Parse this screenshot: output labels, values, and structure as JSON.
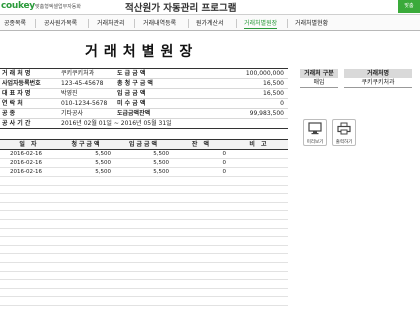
{
  "header": {
    "logo": "coukey",
    "logo_sub": "맞춤형엑셀업무자동화",
    "title": "적산원가 자동관리 프로그램",
    "corner_button": "맞춤"
  },
  "menu": [
    {
      "label": "공종목록",
      "active": false
    },
    {
      "label": "공사원가목록",
      "active": false
    },
    {
      "label": "거래처관리",
      "active": false
    },
    {
      "label": "거래내역등록",
      "active": false
    },
    {
      "label": "원가계산서",
      "active": false
    },
    {
      "label": "거래처별원장",
      "active": true
    },
    {
      "label": "거래처별현황",
      "active": false
    }
  ],
  "document": {
    "title": "거래처별원장"
  },
  "info": {
    "rows": [
      {
        "l1": "거 래 처 명",
        "v1": "쿠키쿠키처과",
        "l2": "도 급 금 액",
        "v2": "100,000,000"
      },
      {
        "l1": "사업자등록번호",
        "v1": "123-45-45678",
        "l2": "총 청 구 금 액",
        "v2": "16,500"
      },
      {
        "l1": "대 표 자 명",
        "v1": "박영진",
        "l2": "입 금 금 액",
        "v2": "16,500"
      },
      {
        "l1": "연 락 처",
        "v1": "010-1234-5678",
        "l2": "미 수 금 액",
        "v2": "0"
      },
      {
        "l1": "공 종",
        "v1": "기타공사",
        "l2": "도급금액잔액",
        "v2": "99,983,500"
      }
    ],
    "period_label": "공 사 기 간",
    "period_value": "2016년 02월 01일 ~ 2016년 05월 31일"
  },
  "filter": {
    "col1_header": "거래처 구분",
    "col2_header": "거래처명",
    "col1_value": "매입",
    "col2_value": "쿠키쿠키처과"
  },
  "buttons": {
    "preview": "미리보기",
    "print": "출력하기"
  },
  "grid": {
    "headers": [
      "일 자",
      "청구금액",
      "입금금액",
      "잔 액",
      "비 고"
    ],
    "rows": [
      [
        "2016-02-16",
        "5,500",
        "5,500",
        "0",
        ""
      ],
      [
        "2016-02-16",
        "5,500",
        "5,500",
        "0",
        ""
      ],
      [
        "2016-02-16",
        "5,500",
        "5,500",
        "0",
        ""
      ]
    ],
    "empty_rows": 15
  }
}
